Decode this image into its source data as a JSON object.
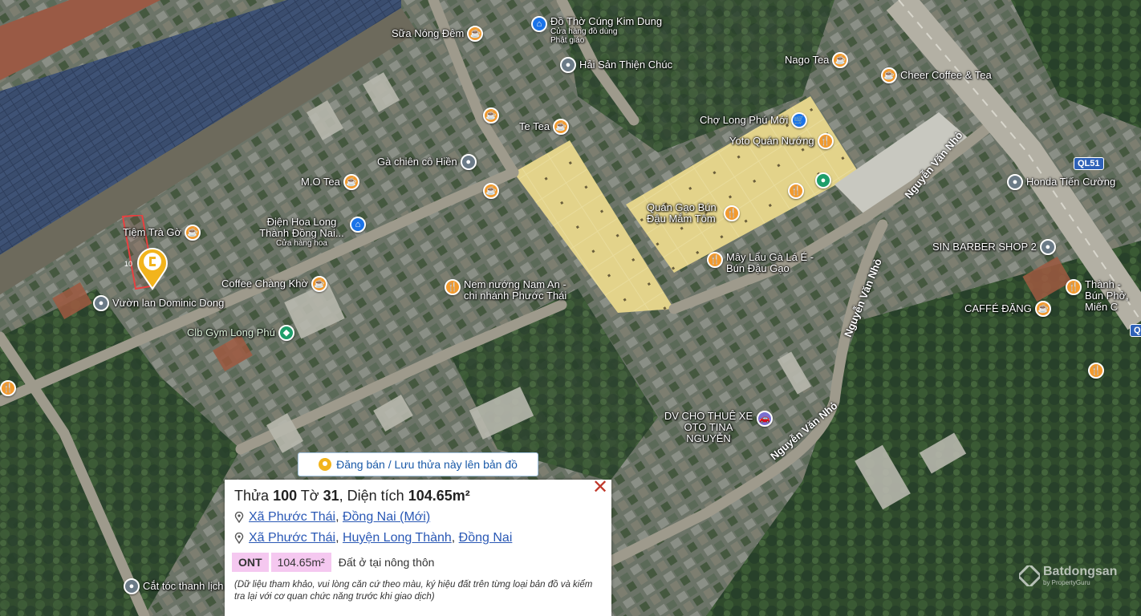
{
  "pois": [
    {
      "id": "sua-nong-dem",
      "label": "Sữa Nóng Đêm",
      "icon": "coffee-icon",
      "color": "#f29a2e"
    },
    {
      "id": "do-tho-cung",
      "label": "Đồ Thờ Cúng Kim Dung",
      "sub": "Cửa hàng đồ dùng Phật giáo",
      "icon": "shopping-bag-icon",
      "color": "#1a73e8"
    },
    {
      "id": "hai-san",
      "label": "Hải Sản Thiện Chúc",
      "icon": "pin-icon",
      "color": "#6b7b88"
    },
    {
      "id": "nago-tea",
      "label": "Nago Tea",
      "icon": "coffee-icon",
      "color": "#f29a2e"
    },
    {
      "id": "cheer-coffee",
      "label": "Cheer Coffee & Tea",
      "icon": "coffee-icon",
      "color": "#f29a2e"
    },
    {
      "id": "te-tea",
      "label": "Te Tea",
      "icon": "coffee-icon",
      "color": "#f29a2e"
    },
    {
      "id": "cho-long-phu",
      "label": "Chợ Long Phú Mới",
      "icon": "cart-icon",
      "color": "#1a73e8"
    },
    {
      "id": "yoto",
      "label": "Yoto Quán Nướng",
      "icon": "fork-knife-icon",
      "color": "#f29a2e"
    },
    {
      "id": "ga-chien",
      "label": "Gà chiên cô Hiền",
      "icon": "pin-icon",
      "color": "#6b7b88"
    },
    {
      "id": "mo-tea",
      "label": "M.O Tea",
      "icon": "coffee-icon",
      "color": "#f29a2e"
    },
    {
      "id": "honda",
      "label": "Honda Tiến Cường",
      "icon": "pin-icon",
      "color": "#6b7b88"
    },
    {
      "id": "quan-gao",
      "label": "Quán Gạo Bún Đậu Mắm Tôm",
      "icon": "fork-knife-icon",
      "color": "#f29a2e"
    },
    {
      "id": "dien-hoa",
      "label": "Điện Hoa Long Thành Đồng Nai...",
      "sub": "Cửa hàng hoa",
      "icon": "shopping-bag-icon",
      "color": "#1a73e8"
    },
    {
      "id": "tiem-tra",
      "label": "Tiệm Trà Gờ",
      "icon": "coffee-icon",
      "color": "#f29a2e"
    },
    {
      "id": "sin-barber",
      "label": "SIN BARBER SHOP 2",
      "icon": "pin-icon",
      "color": "#6b7b88"
    },
    {
      "id": "may-lau",
      "label": "Mây Lẩu Gà Lá É - Bún Đậu Gạo",
      "icon": "fork-knife-icon",
      "color": "#f29a2e"
    },
    {
      "id": "coffee-chang",
      "label": "Coffee Chàng Khờ",
      "icon": "coffee-icon",
      "color": "#f29a2e"
    },
    {
      "id": "nem-nuong",
      "label": "Nem nướng Nam An - chi nhánh Phước Thái",
      "icon": "fork-knife-icon",
      "color": "#f29a2e"
    },
    {
      "id": "thanh-bun",
      "label": "Thành - Bún Phở, Miến C",
      "icon": "fork-knife-icon",
      "color": "#f29a2e"
    },
    {
      "id": "vuon-lan",
      "label": "Vườn lan Dominic Dong",
      "icon": "pin-icon",
      "color": "#6b7b88"
    },
    {
      "id": "caffe-dang",
      "label": "CAFFÉ ĐẶNG",
      "icon": "coffee-icon",
      "color": "#f29a2e"
    },
    {
      "id": "clb-gym",
      "label": "Clb Gym Long Phú",
      "icon": "dumbbell-icon",
      "color": "#1e9e6a"
    },
    {
      "id": "dv-thue-xe",
      "label": "DV CHO THUÊ XE OTO TINA NGUYỄN",
      "icon": "car-icon",
      "color": "#7a6fd0"
    },
    {
      "id": "cat-toc",
      "label": "Cắt tóc thanh lịch",
      "icon": "pin-icon",
      "color": "#6b7b88"
    }
  ],
  "roads": {
    "nvn1": "Nguyễn Văn Nhỏ",
    "nvn2": "Nguyễn Văn Nhỏ",
    "nvn3": "Nguyễn Văn Nhỏ",
    "highway_shield": "QL51",
    "highway_shield2": "Q"
  },
  "parcel": {
    "edge_label": "10",
    "side_label": "104"
  },
  "action_banner": {
    "label": "Đăng bán / Lưu thửa này lên bản đồ"
  },
  "panel": {
    "title_prefix": "Thửa ",
    "lot_number": "100",
    "sheet_prefix": " Tờ ",
    "sheet_number": "31",
    "area_prefix": ", Diện tích ",
    "area": "104.65m²",
    "address_new": [
      "Xã Phước Thái",
      "Đồng Nai (Mới)"
    ],
    "address_old": [
      "Xã Phước Thái",
      "Huyện Long Thành",
      "Đồng Nai"
    ],
    "zone_code": "ONT",
    "zone_area": "104.65m²",
    "zone_desc": "Đất ở tại nông thôn",
    "note": "(Dữ liệu tham khảo, vui lòng căn cứ theo màu, ký hiệu đất trên từng loại bản đồ và kiểm tra lại với cơ quan chức năng trước khi giao dịch)",
    "close_icon": "close-icon"
  },
  "watermark": {
    "brand": "Batdongsan",
    "sub": "by PropertyGuru",
    "small": "com.vn"
  },
  "colors": {
    "accent": "#2a58b5",
    "zone_chip": "#f5c8f0",
    "close": "#c0392b",
    "poi_food": "#f29a2e"
  }
}
